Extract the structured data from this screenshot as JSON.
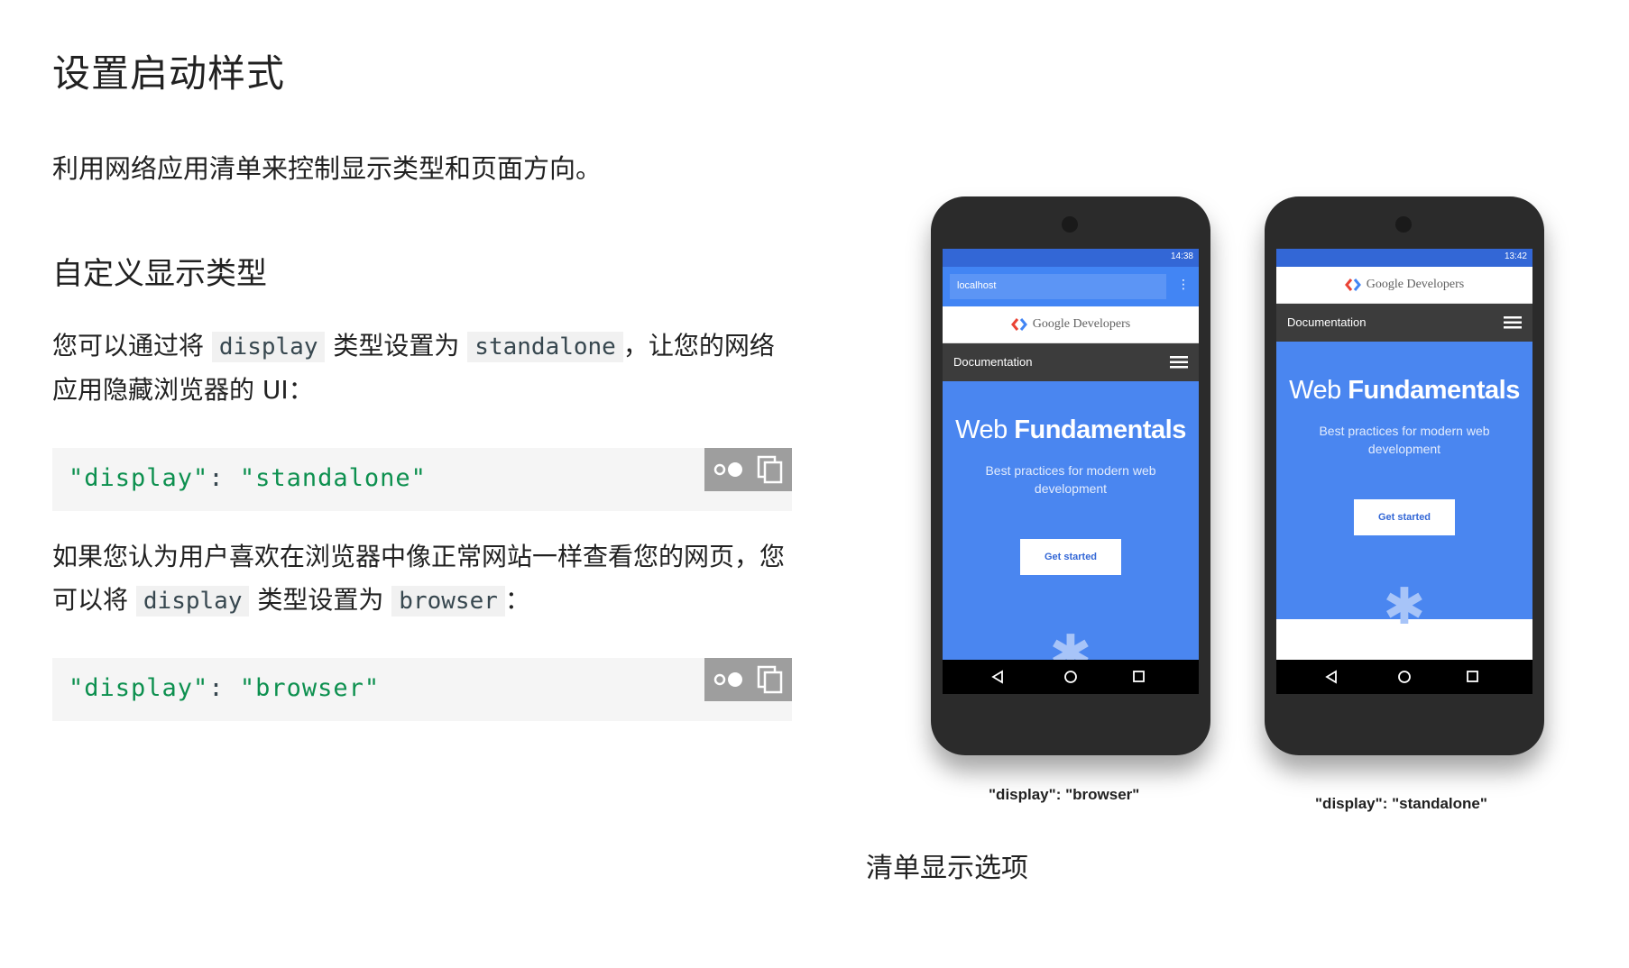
{
  "page": {
    "title": "设置启动样式",
    "intro": "利用网络应用清单来控制显示类型和页面方向。",
    "section_title": "自定义显示类型",
    "para1": {
      "before": "您可以通过将 ",
      "code1": "display",
      "middle": " 类型设置为 ",
      "code2": "standalone",
      "after": "，让您的网络应用隐藏浏览器的 UI："
    },
    "code_block_1": {
      "key": "\"display\"",
      "colon": ": ",
      "value": "\"standalone\""
    },
    "para2": {
      "before": "如果您认为用户喜欢在浏览器中像正常网站一样查看您的网页，您可以将 ",
      "code1": "display",
      "middle": " 类型设置为 ",
      "code2": "browser",
      "after": "："
    },
    "code_block_2": {
      "key": "\"display\"",
      "colon": ": ",
      "value": "\"browser\""
    },
    "figure_caption": "清单显示选项"
  },
  "phones": [
    {
      "time": "14:38",
      "address": "localhost",
      "brand": "Google Developers",
      "nav_label": "Documentation",
      "hero_title_light": "Web",
      "hero_title_bold": "Fundamentals",
      "hero_subtitle": "Best practices for modern web development",
      "button": "Get started",
      "caption": "\"display\": \"browser\""
    },
    {
      "time": "13:42",
      "brand": "Google Developers",
      "nav_label": "Documentation",
      "hero_title_light": "Web",
      "hero_title_bold": "Fundamentals",
      "hero_subtitle": "Best practices for modern web development",
      "button": "Get started",
      "caption": "\"display\": \"standalone\""
    }
  ],
  "colors": {
    "code_string": "#0d904f",
    "hero_blue": "#4a86f0",
    "status_blue": "#3367d6",
    "tool_gray": "#9e9e9e"
  },
  "icons": [
    "toggle-theme-icon",
    "copy-icon",
    "google-logo-icon",
    "hamburger-menu-icon",
    "back-icon",
    "home-icon",
    "recents-icon"
  ]
}
